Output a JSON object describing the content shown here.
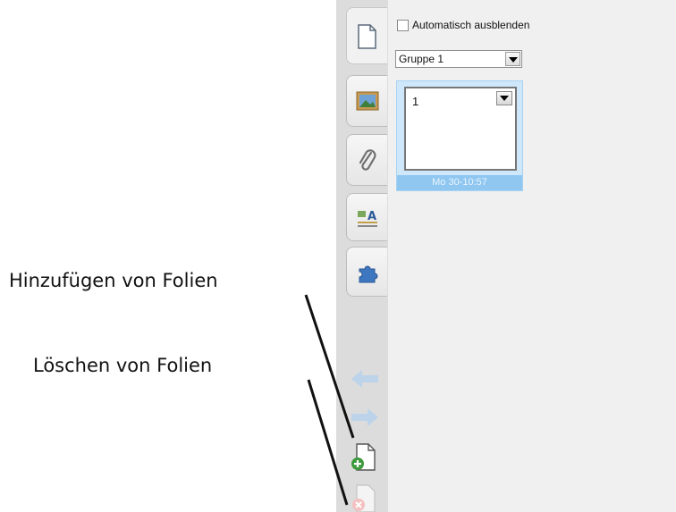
{
  "annotations": {
    "add": "Hinzufügen von Folien",
    "delete": "Löschen von Folien"
  },
  "sidebar": {
    "tabs": [
      {
        "icon": "page-icon",
        "active": true
      },
      {
        "icon": "gallery-image-icon",
        "active": false
      },
      {
        "icon": "paperclip-icon",
        "active": false
      },
      {
        "icon": "properties-icon",
        "active": false
      },
      {
        "icon": "addons-puzzle-icon",
        "active": false
      }
    ],
    "buttons": [
      "arrow-left-icon",
      "arrow-right-icon",
      "add-page-icon",
      "delete-page-icon"
    ]
  },
  "panel": {
    "autohide_label": "Automatisch ausblenden",
    "group_select_value": "Gruppe 1",
    "page_thumb": {
      "number": "1",
      "timestamp": "Mo 30-10:57"
    }
  },
  "colors": {
    "thumb_selected_bg": "#cfe7fb",
    "thumb_date_bg": "#8fc7f1",
    "tabstrip_bg": "#dcdcdc",
    "panel_bg": "#f0f0f0"
  }
}
